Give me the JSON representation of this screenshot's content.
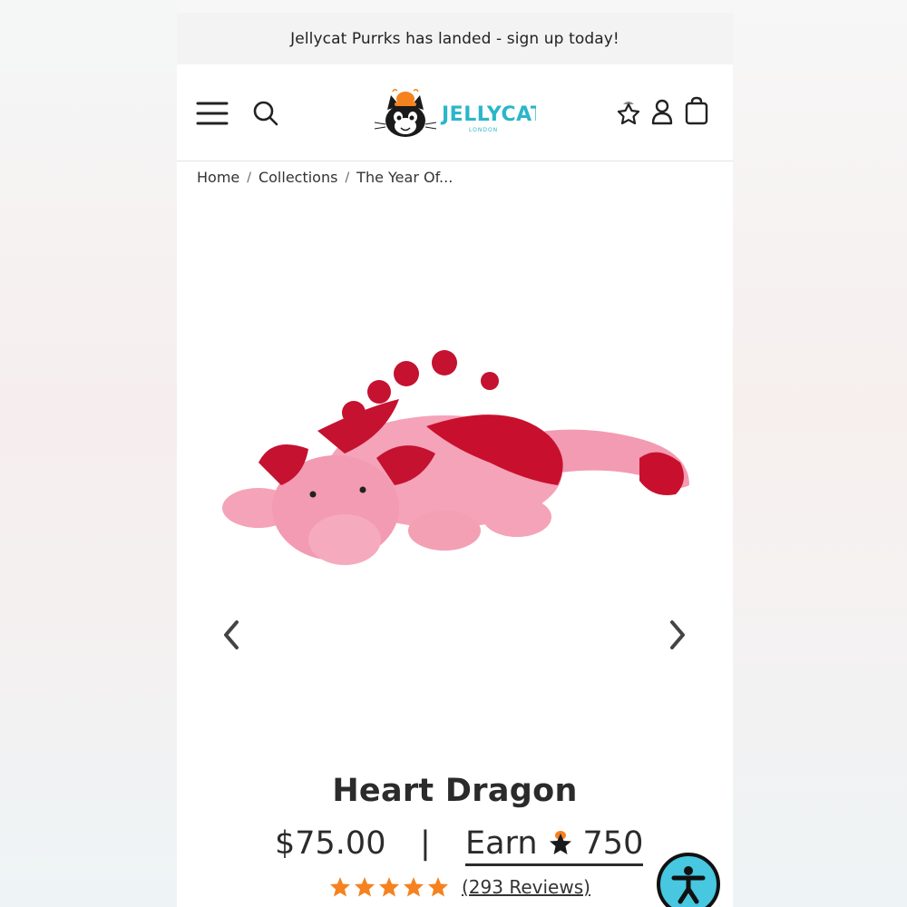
{
  "announcement": {
    "text": "Jellycat Purrks has landed - sign up today!"
  },
  "header": {
    "logo_text": "JELLYCAT",
    "logo_subtext": "LONDON"
  },
  "breadcrumb": {
    "items": [
      "Home",
      "Collections",
      "The Year Of..."
    ],
    "separator": "/"
  },
  "product": {
    "title": "Heart Dragon",
    "price": "$75.00",
    "divider": "|",
    "earn_label": "Earn",
    "earn_points": "750",
    "rating_stars": 5,
    "reviews_text": "(293 Reviews)"
  },
  "colors": {
    "accent_star": "#f5821f",
    "a11y_button": "#47c7e0",
    "logo_teal": "#2bb6c9"
  },
  "icons": [
    "menu-icon",
    "search-icon",
    "wishlist-star-icon",
    "account-icon",
    "shopping-bag-icon",
    "chevron-left-icon",
    "chevron-right-icon",
    "star-icon",
    "accessibility-icon"
  ]
}
